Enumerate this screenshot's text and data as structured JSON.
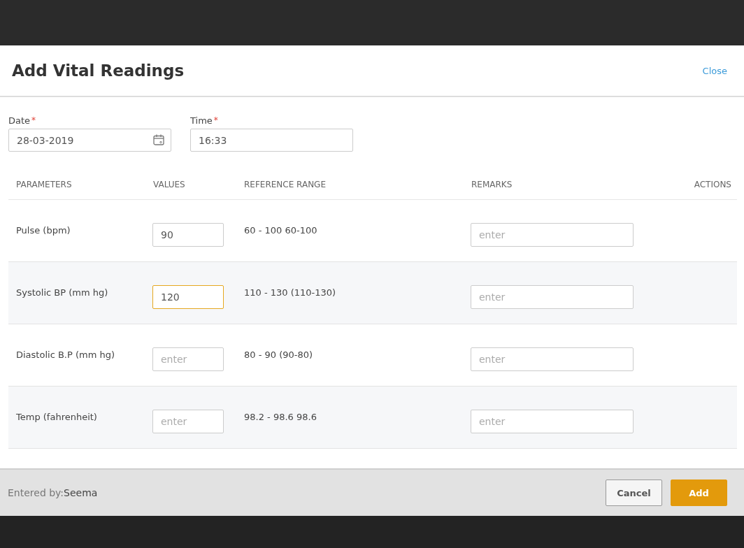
{
  "dialog": {
    "title": "Add Vital Readings",
    "close": "Close"
  },
  "fields": [
    {
      "kind": "date",
      "label": "Date",
      "required": true,
      "required_mark": "*",
      "value": "28-03-2019"
    },
    {
      "kind": "time",
      "label": "Time",
      "required": true,
      "required_mark": "*",
      "value": "16:33"
    }
  ],
  "table": {
    "columns": [
      "PARAMETERS",
      "VALUES",
      "REFERENCE RANGE",
      "REMARKS",
      "ACTIONS"
    ],
    "rows": [
      {
        "parameter": "Pulse (bpm)",
        "value": "90",
        "focused": false,
        "range": "60 - 100 60-100",
        "remarks_placeholder": "enter"
      },
      {
        "parameter": "Systolic BP (mm hg)",
        "value": "120",
        "focused": true,
        "range": "110 - 130 (110-130)",
        "remarks_placeholder": "enter"
      },
      {
        "parameter": "Diastolic B.P (mm hg)",
        "value_placeholder": "enter",
        "focused": false,
        "range": "80 - 90 (90-80)",
        "remarks_placeholder": "enter"
      },
      {
        "parameter": "Temp (fahrenheit)",
        "value_placeholder": "enter",
        "focused": false,
        "range": "98.2 - 98.6 98.6",
        "remarks_placeholder": "enter"
      }
    ]
  },
  "footer": {
    "entered_by_label": "Entered by:",
    "entered_by": "Seema",
    "buttons": [
      {
        "kind": "secondary",
        "label": "Cancel"
      },
      {
        "kind": "primary",
        "label": "Add"
      }
    ]
  }
}
